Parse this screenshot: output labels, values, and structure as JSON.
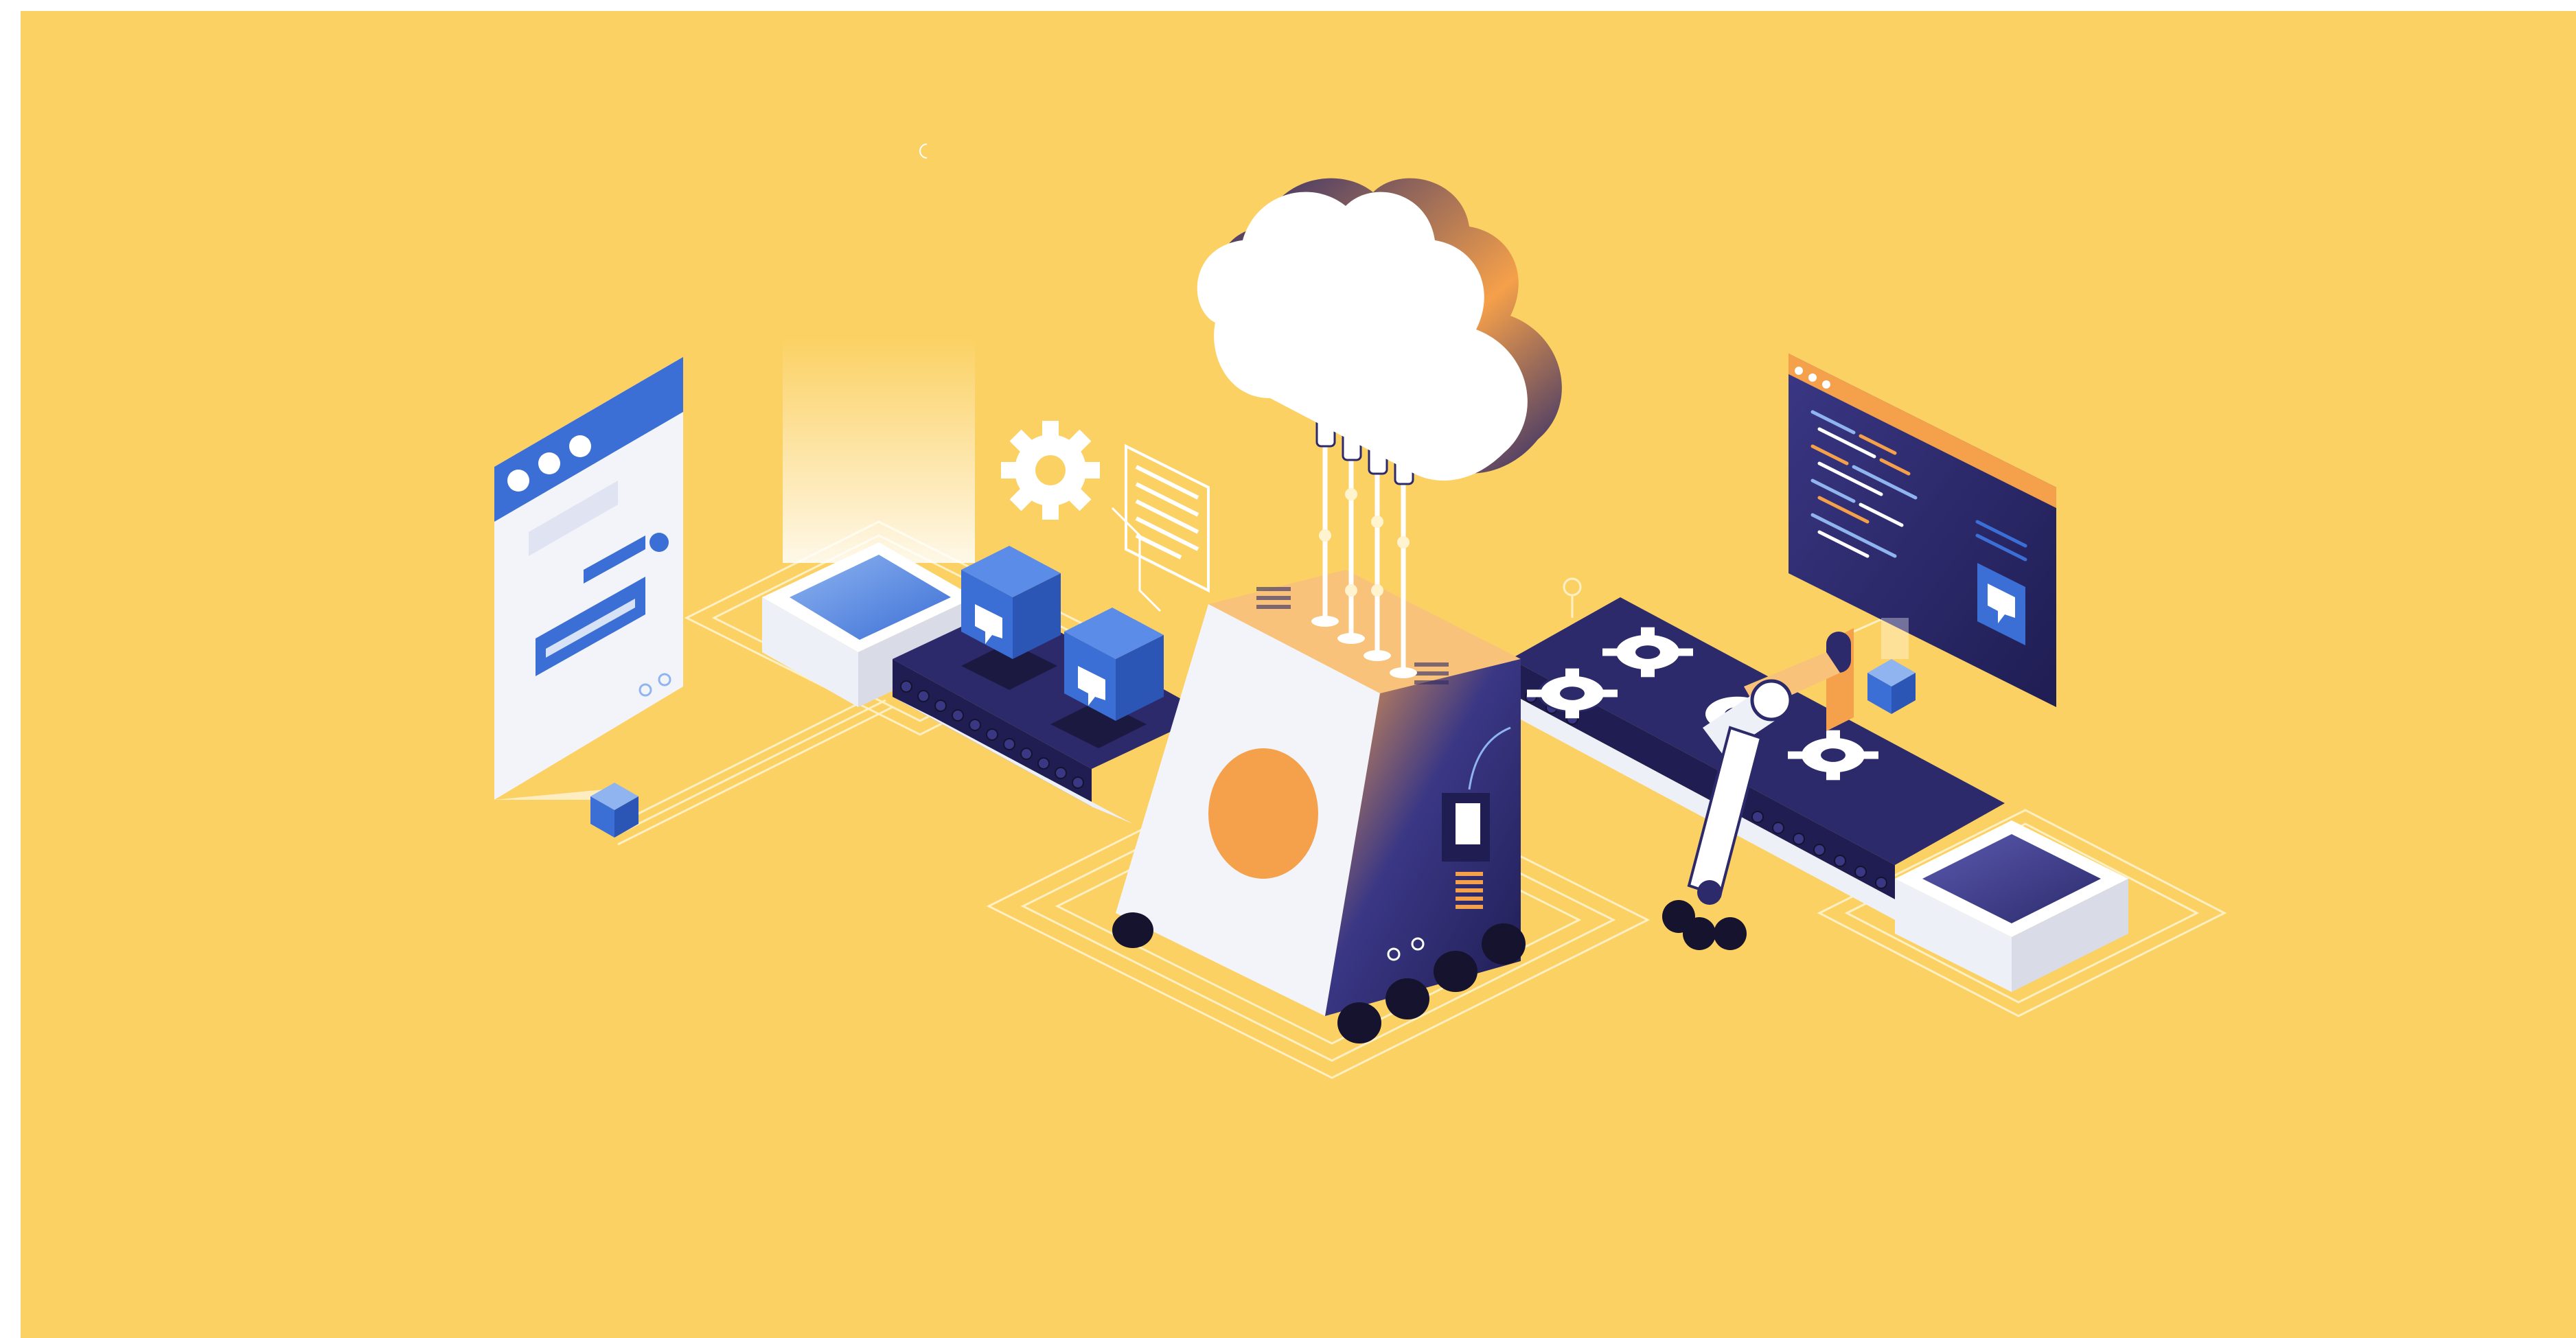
{
  "scene": {
    "description_free": true,
    "colors": {
      "page": "#ffffff",
      "background": "#fcd163",
      "navy": "#2c2a6b",
      "navy_dark": "#1f1d52",
      "blue": "#3b6fd6",
      "blue_light": "#8fb4f0",
      "orange": "#f5a04a",
      "orange_light": "#f9c27a",
      "white": "#ffffff",
      "pale": "#eef0f7",
      "grey": "#d9dbe6",
      "black": "#15132e",
      "line": "#fff4cf"
    },
    "icons": [
      "cloud-icon",
      "gear-icon",
      "robot-arm-icon",
      "browser-window-icon",
      "code-window-icon",
      "chat-bubble-icon",
      "conveyor-belt-icon",
      "cube-icon"
    ]
  }
}
